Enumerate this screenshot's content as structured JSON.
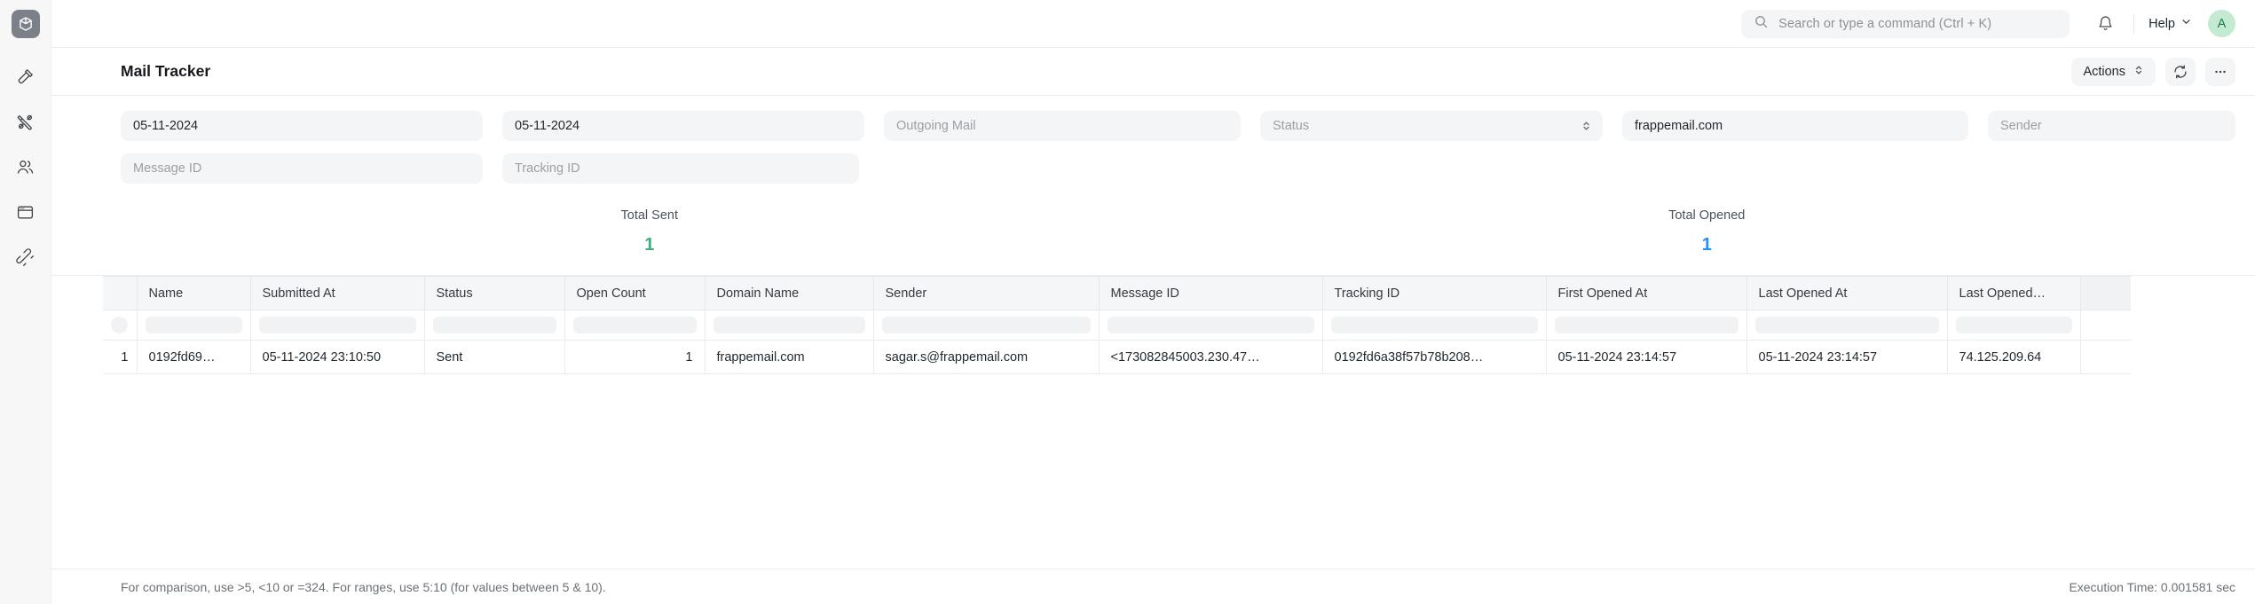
{
  "sidebar": {
    "logo_icon": "cube-logo-icon",
    "items": [
      {
        "icon": "hammer-icon",
        "name": "build-tools"
      },
      {
        "icon": "tools-icon",
        "name": "utilities"
      },
      {
        "icon": "users-icon",
        "name": "users"
      },
      {
        "icon": "window-icon",
        "name": "website"
      },
      {
        "icon": "connect-icon",
        "name": "integrations"
      }
    ]
  },
  "topbar": {
    "search": {
      "placeholder": "Search or type a command (Ctrl + K)",
      "value": ""
    },
    "notifications_icon": "bell-icon",
    "help_label": "Help",
    "avatar_initial": "A"
  },
  "page": {
    "title": "Mail Tracker",
    "actions_label": "Actions",
    "refresh_icon": "refresh-icon",
    "more_icon": "ellipsis-icon"
  },
  "filters": {
    "row1": [
      {
        "name": "from-date",
        "value": "05-11-2024",
        "placeholder": "",
        "type": "date"
      },
      {
        "name": "to-date",
        "value": "05-11-2024",
        "placeholder": "",
        "type": "date"
      },
      {
        "name": "outgoing-mail",
        "value": "",
        "placeholder": "Outgoing Mail",
        "type": "text"
      },
      {
        "name": "status",
        "value": "",
        "placeholder": "Status",
        "type": "select"
      },
      {
        "name": "domain-name",
        "value": "frappemail.com",
        "placeholder": "",
        "type": "text"
      },
      {
        "name": "sender",
        "value": "",
        "placeholder": "Sender",
        "type": "text"
      }
    ],
    "row2": [
      {
        "name": "message-id",
        "value": "",
        "placeholder": "Message ID",
        "type": "text"
      },
      {
        "name": "tracking-id",
        "value": "",
        "placeholder": "Tracking ID",
        "type": "text"
      }
    ]
  },
  "stats": [
    {
      "label": "Total Sent",
      "value": "1",
      "color": "#3eaf7c"
    },
    {
      "label": "Total Opened",
      "value": "1",
      "color": "#2490ef"
    }
  ],
  "table": {
    "columns": [
      "Name",
      "Submitted At",
      "Status",
      "Open Count",
      "Domain Name",
      "Sender",
      "Message ID",
      "Tracking ID",
      "First Opened At",
      "Last Opened At",
      "Last Opened…"
    ],
    "rows": [
      {
        "index": "1",
        "cells": [
          "0192fd69…",
          "05-11-2024 23:10:50",
          "Sent",
          "1",
          "frappemail.com",
          "sagar.s@frappemail.com",
          "<173082845003.230.47…",
          "0192fd6a38f57b78b208…",
          "05-11-2024 23:14:57",
          "05-11-2024 23:14:57",
          "74.125.209.64"
        ]
      }
    ]
  },
  "footer": {
    "hint": "For comparison, use >5, <10 or =324. For ranges, use 5:10 (for values between 5 & 10).",
    "execution_time": "Execution Time: 0.001581 sec"
  }
}
